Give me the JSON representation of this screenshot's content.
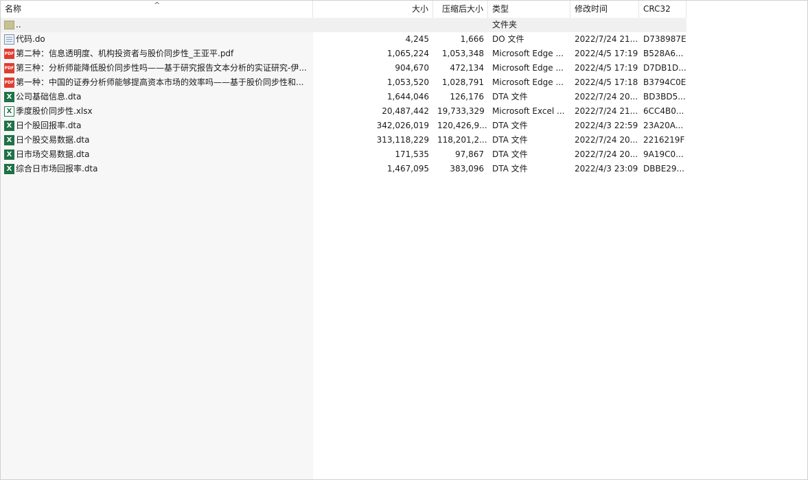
{
  "columns": {
    "name": "名称",
    "size": "大小",
    "compressed": "压缩后大小",
    "type": "类型",
    "modified": "修改时间",
    "crc": "CRC32"
  },
  "sort_arrow": "^",
  "rows": [
    {
      "icon": "folder-icon",
      "name": "..",
      "size": "",
      "compressed": "",
      "type": "文件夹",
      "modified": "",
      "crc": ""
    },
    {
      "icon": "do-file-icon",
      "name": "代码.do",
      "size": "4,245",
      "compressed": "1,666",
      "type": "DO 文件",
      "modified": "2022/7/24 21...",
      "crc": "D738987E"
    },
    {
      "icon": "pdf-icon",
      "name": "第二种：信息透明度、机构投资者与股价同步性_王亚平.pdf",
      "size": "1,065,224",
      "compressed": "1,053,348",
      "type": "Microsoft Edge ...",
      "modified": "2022/4/5 17:19",
      "crc": "B528A6..."
    },
    {
      "icon": "pdf-icon",
      "name": "第三种：分析师能降低股价同步性吗——基于研究报告文本分析的实证研究-伊...",
      "size": "904,670",
      "compressed": "472,134",
      "type": "Microsoft Edge ...",
      "modified": "2022/4/5 17:19",
      "crc": "D7DB1D..."
    },
    {
      "icon": "pdf-icon",
      "name": "第一种：中国的证券分析师能够提高资本市场的效率吗——基于股价同步性和...",
      "size": "1,053,520",
      "compressed": "1,028,791",
      "type": "Microsoft Edge ...",
      "modified": "2022/4/5 17:18",
      "crc": "B3794C0E"
    },
    {
      "icon": "excel-icon",
      "name": "公司基础信息.dta",
      "size": "1,644,046",
      "compressed": "126,176",
      "type": "DTA 文件",
      "modified": "2022/7/24 20...",
      "crc": "BD3BD5..."
    },
    {
      "icon": "xlsx-icon",
      "name": "季度股价同步性.xlsx",
      "size": "20,487,442",
      "compressed": "19,733,329",
      "type": "Microsoft Excel ...",
      "modified": "2022/7/24 21...",
      "crc": "6CC4B0..."
    },
    {
      "icon": "excel-icon",
      "name": "日个股回报率.dta",
      "size": "342,026,019",
      "compressed": "120,426,9...",
      "type": "DTA 文件",
      "modified": "2022/4/3 22:59",
      "crc": "23A20A..."
    },
    {
      "icon": "excel-icon",
      "name": "日个股交易数据.dta",
      "size": "313,118,229",
      "compressed": "118,201,2...",
      "type": "DTA 文件",
      "modified": "2022/7/24 20...",
      "crc": "2216219F"
    },
    {
      "icon": "excel-icon",
      "name": "日市场交易数据.dta",
      "size": "171,535",
      "compressed": "97,867",
      "type": "DTA 文件",
      "modified": "2022/7/24 20...",
      "crc": "9A19C0..."
    },
    {
      "icon": "excel-icon",
      "name": "综合日市场回报率.dta",
      "size": "1,467,095",
      "compressed": "383,096",
      "type": "DTA 文件",
      "modified": "2022/4/3 23:09",
      "crc": "DBBE29..."
    }
  ],
  "colors": {
    "pdf": "#e03c31",
    "excel": "#1f7246",
    "folder": "#c7c193",
    "sorted_column_bg": "#f7f7f7"
  }
}
